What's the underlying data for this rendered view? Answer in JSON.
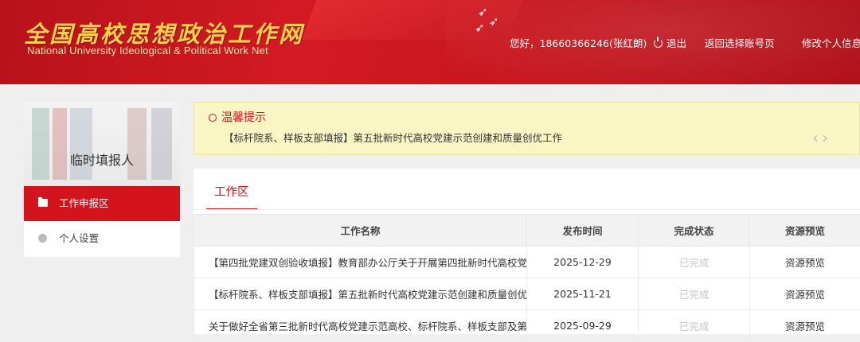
{
  "header": {
    "logo_cn": "全国高校思想政治工作网",
    "logo_en": "National University Ideological & Political Work Net",
    "greeting": "您好，18660366246(张红朗)",
    "logout": "退出",
    "back_to_accounts": "返回选择账号页",
    "edit_profile": "修改个人信息"
  },
  "sidebar": {
    "title": "临时填报人",
    "items": [
      {
        "label": "工作申报区",
        "icon": "folder-icon",
        "active": true
      },
      {
        "label": "个人设置",
        "icon": "gear-icon",
        "active": false
      }
    ]
  },
  "notice": {
    "title": "温馨提示",
    "message": "【标杆院系、样板支部填报】第五批新时代高校党建示范创建和质量创优工作"
  },
  "work": {
    "tab": "工作区",
    "columns": [
      "工作名称",
      "发布时间",
      "完成状态",
      "资源预览"
    ],
    "rows": [
      {
        "name": "【第四批党建双创验收填报】教育部办公厅关于开展第四批新时代高校党建",
        "date": "2025-12-29",
        "status": "已完成",
        "preview": "资源预览"
      },
      {
        "name": "【标杆院系、样板支部填报】第五批新时代高校党建示范创建和质量创优工",
        "date": "2025-11-21",
        "status": "已完成",
        "preview": "资源预览"
      },
      {
        "name": "关于做好全省第三批新时代高校党建示范高校、标杆院系、样板支部及第二",
        "date": "2025-09-29",
        "status": "已完成",
        "preview": "资源预览"
      }
    ]
  },
  "colors": {
    "brand_red": "#d4141c",
    "notice_bg": "#faf6c4"
  }
}
